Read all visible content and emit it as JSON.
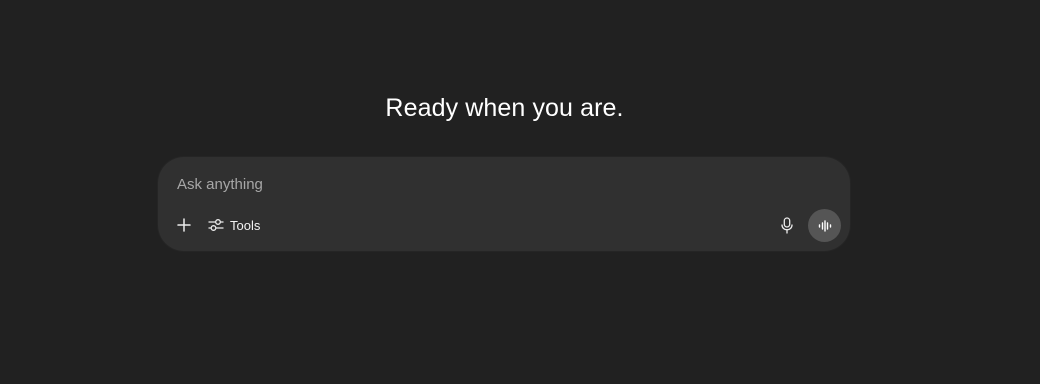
{
  "main": {
    "headline": "Ready when you are."
  },
  "composer": {
    "placeholder": "Ask anything",
    "value": "",
    "add_icon": "plus-icon",
    "tools_icon": "sliders-icon",
    "tools_label": "Tools",
    "mic_icon": "microphone-icon",
    "voice_icon": "waveform-icon"
  },
  "colors": {
    "background": "#212121",
    "composer_background": "#303030",
    "voice_button_background": "#555555",
    "text": "#ffffff",
    "placeholder": "#a7a7a7"
  }
}
